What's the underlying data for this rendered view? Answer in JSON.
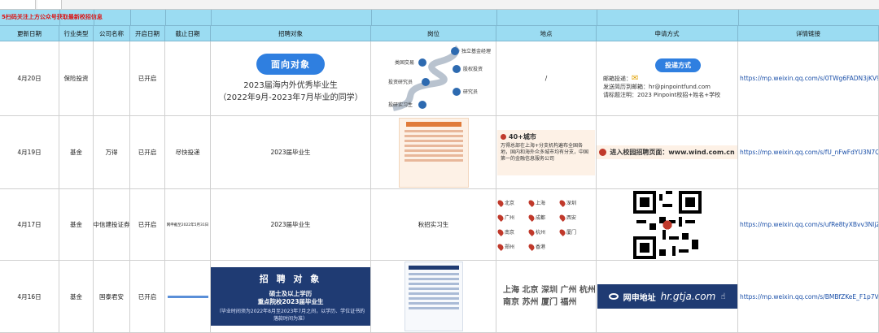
{
  "note": "5扫码关注上方公众号获取最新校招信息",
  "headers": {
    "update": "更新日期",
    "industry": "行业类型",
    "company": "公司名称",
    "open": "开启日期",
    "deadline": "截止日期",
    "target": "招聘对象",
    "position": "岗位",
    "location": "地点",
    "apply": "申请方式",
    "detail": "详情链接"
  },
  "rows": [
    {
      "date": "4月20日",
      "industry": "保险投资",
      "company": "",
      "open": "已开启",
      "deadline": "",
      "target_pill": "面向对象",
      "target_line1": "2023届海内外优秀毕业生",
      "target_line2": "（2022年9月-2023年7月毕业的同学）",
      "position_roles": [
        "独立基金经理",
        "类固交易",
        "股权投资",
        "投资研究员",
        "研究员",
        "投研实习生"
      ],
      "location": "/",
      "apply_pill": "投递方式",
      "apply_mail_label": "邮箱投递：",
      "apply_line1": "发送简历到邮箱：hr@pinpointfund.com",
      "apply_line2": "请标题注明：2023 Pinpoint校招+姓名+学校",
      "link": "https://mp.weixin.qq.com/s/0TWg6FADN3jKV95f5x"
    },
    {
      "date": "4月19日",
      "industry": "基金",
      "company": "万得",
      "open": "已开启",
      "deadline": "尽快投递",
      "target": "2023届毕业生",
      "location_title": "40+城市",
      "location_desc": "万得总部在上海+分支机构遍布全国各地，国内和海外众多城市均有分支，中国第一的金融信息服务公司",
      "apply_text": "进入校园招聘页面：www.wind.com.cn",
      "link": "https://mp.weixin.qq.com/s/fU_nFwFdYU3N7QVoaH"
    },
    {
      "date": "4月17日",
      "industry": "基金",
      "company": "中信建投证券",
      "open": "已开启",
      "deadline": "网申截至2022年5月31日",
      "target": "2023届毕业生",
      "position": "秋招实习生",
      "cities": [
        "北京",
        "上海",
        "深圳",
        "广州",
        "成都",
        "西安",
        "南京",
        "杭州",
        "厦门",
        "郑州",
        "香港"
      ],
      "link": "https://mp.weixin.qq.com/s/ufRe8tyXBvv3NljZuqBw"
    },
    {
      "date": "4月16日",
      "industry": "基金",
      "company": "国泰君安",
      "open": "已开启",
      "deadline": "",
      "target_title": "招 聘 对 象",
      "target_l1": "硕士及以上学历",
      "target_l2": "重点院校2023届毕业生",
      "target_small": "（毕业时间须为2022年8月至2023年7月之间，以学历、学位证书的落款时间为准）",
      "cities_l1": "上海 北京 深圳 广州 杭州",
      "cities_l2": "南京 苏州 厦门 福州",
      "apply_label": "网申地址",
      "apply_url": "hr.gtja.com",
      "link": "https://mp.weixin.qq.com/s/BMBfZKeE_F1p7VitF4V"
    }
  ]
}
